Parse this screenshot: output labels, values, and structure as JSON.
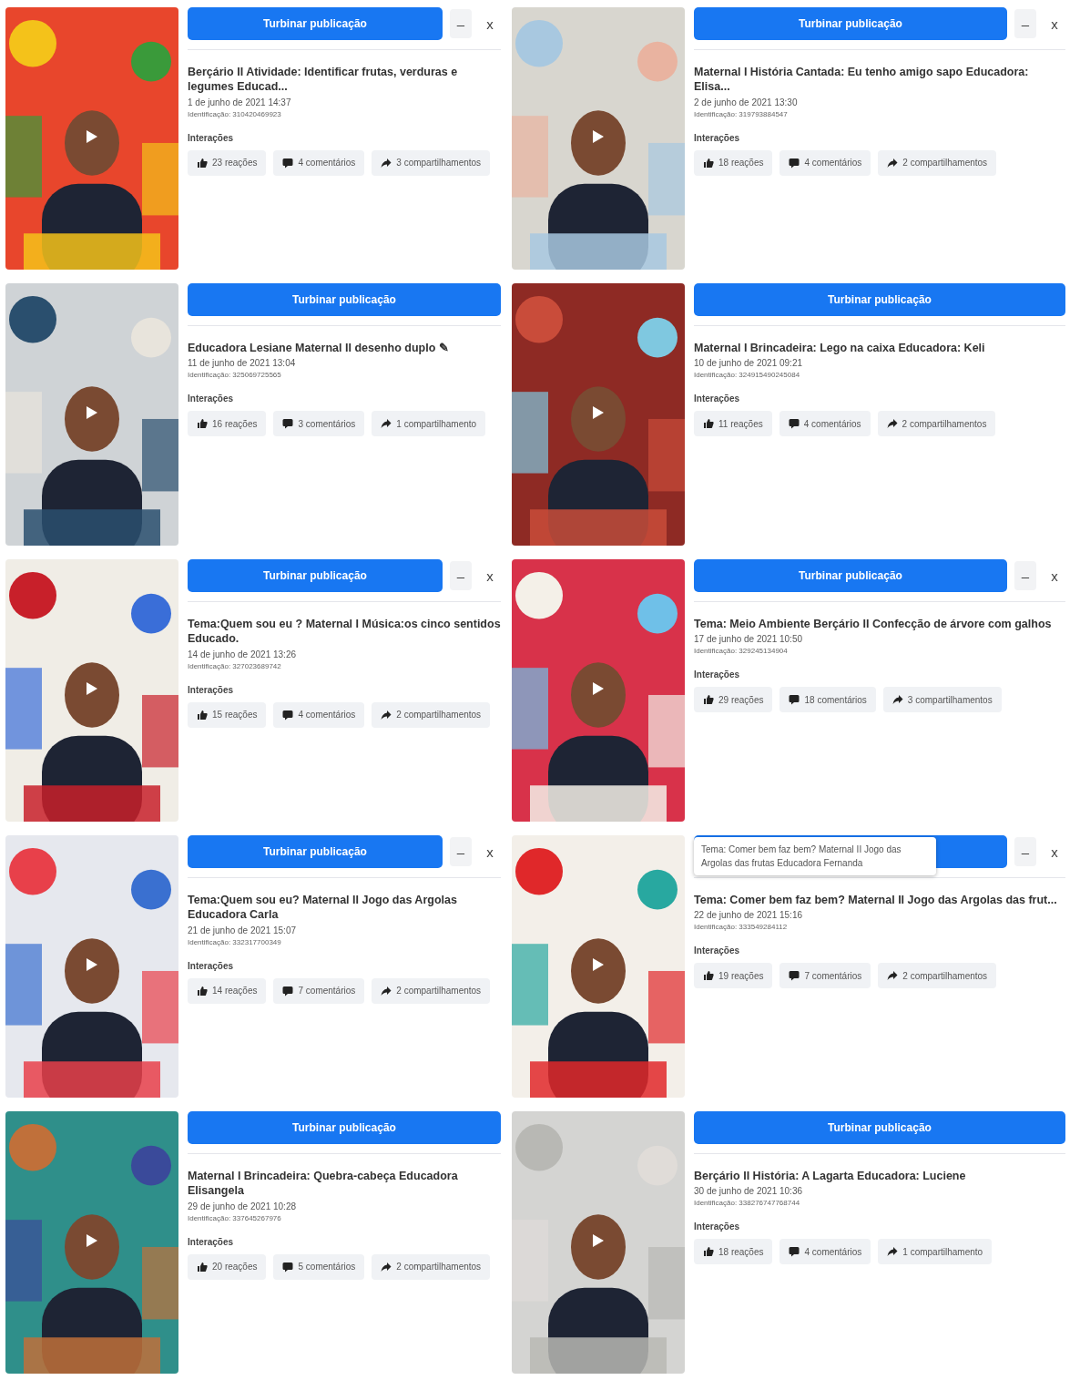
{
  "posts": [
    {
      "boost_label": "Turbinar publicação",
      "controls": {
        "minimize": "–",
        "close": "x"
      },
      "title": "Berçário II Atividade: Identificar frutas, verduras e legumes Educad...",
      "date": "1 de junho de 2021 14:37",
      "id": "Identificação: 310420469923",
      "interactions_label": "Interações",
      "reactions": "23 reações",
      "comments": "4 comentários",
      "shares": "3 compartilhamentos"
    },
    {
      "boost_label": "Turbinar publicação",
      "controls": {
        "minimize": "–",
        "close": "x"
      },
      "title": "Maternal I História Cantada: Eu tenho amigo sapo Educadora: Elisa...",
      "date": "2 de junho de 2021 13:30",
      "id": "Identificação: 319793884547",
      "interactions_label": "Interações",
      "reactions": "18 reações",
      "comments": "4 comentários",
      "shares": "2 compartilhamentos"
    },
    {
      "boost_label": "Turbinar publicação",
      "title": "Educadora Lesiane Maternal II desenho duplo ✎",
      "date": "11 de junho de 2021 13:04",
      "id": "Identificação: 325069725565",
      "interactions_label": "Interações",
      "reactions": "16 reações",
      "comments": "3 comentários",
      "shares": "1 compartilhamento"
    },
    {
      "boost_label": "Turbinar publicação",
      "title": "Maternal I Brincadeira: Lego na caixa Educadora: Keli",
      "date": "10 de junho de 2021 09:21",
      "id": "Identificação: 324915490245084",
      "interactions_label": "Interações",
      "reactions": "11 reações",
      "comments": "4 comentários",
      "shares": "2 compartilhamentos"
    },
    {
      "boost_label": "Turbinar publicação",
      "controls": {
        "minimize": "–",
        "close": "x"
      },
      "title": "Tema:Quem sou eu ? Maternal I Música:os cinco sentidos Educado.",
      "date": "14 de junho de 2021 13:26",
      "id": "Identificação: 327023689742",
      "interactions_label": "Interações",
      "reactions": "15 reações",
      "comments": "4 comentários",
      "shares": "2 compartilhamentos"
    },
    {
      "boost_label": "Turbinar publicação",
      "controls": {
        "minimize": "–",
        "close": "x"
      },
      "title": "Tema: Meio Ambiente Berçário II Confecção de árvore com galhos",
      "date": "17 de junho de 2021 10:50",
      "id": "Identificação: 329245134904",
      "interactions_label": "Interações",
      "reactions": "29 reações",
      "comments": "18 comentários",
      "shares": "3 compartilhamentos"
    },
    {
      "boost_label": "Turbinar publicação",
      "controls": {
        "minimize": "–",
        "close": "x"
      },
      "title": "Tema:Quem sou eu? Maternal II Jogo das Argolas Educadora Carla",
      "date": "21 de junho de 2021 15:07",
      "id": "Identificação: 332317700349",
      "interactions_label": "Interações",
      "reactions": "14 reações",
      "comments": "7 comentários",
      "shares": "2 compartilhamentos"
    },
    {
      "controls": {
        "minimize": "–",
        "close": "x"
      },
      "tooltip": "Tema: Comer bem faz bem? Maternal II Jogo das Argolas das frutas Educadora Fernanda",
      "title": "Tema: Comer bem faz bem? Maternal II Jogo das Argolas das frut...",
      "date": "22 de junho de 2021 15:16",
      "id": "Identificação: 333549284112",
      "interactions_label": "Interações",
      "reactions": "19 reações",
      "comments": "7 comentários",
      "shares": "2 compartilhamentos"
    },
    {
      "boost_label": "Turbinar publicação",
      "title": "Maternal I Brincadeira: Quebra-cabeça Educadora Elisangela",
      "date": "29 de junho de 2021 10:28",
      "id": "Identificação: 337645267976",
      "interactions_label": "Interações",
      "reactions": "20 reações",
      "comments": "5 comentários",
      "shares": "2 compartilhamentos"
    },
    {
      "boost_label": "Turbinar publicação",
      "title": "Berçário II História: A Lagarta Educadora: Luciene",
      "date": "30 de junho de 2021 10:36",
      "id": "Identificação: 338276747768744",
      "interactions_label": "Interações",
      "reactions": "18 reações",
      "comments": "4 comentários",
      "shares": "1 compartilhamento"
    }
  ]
}
